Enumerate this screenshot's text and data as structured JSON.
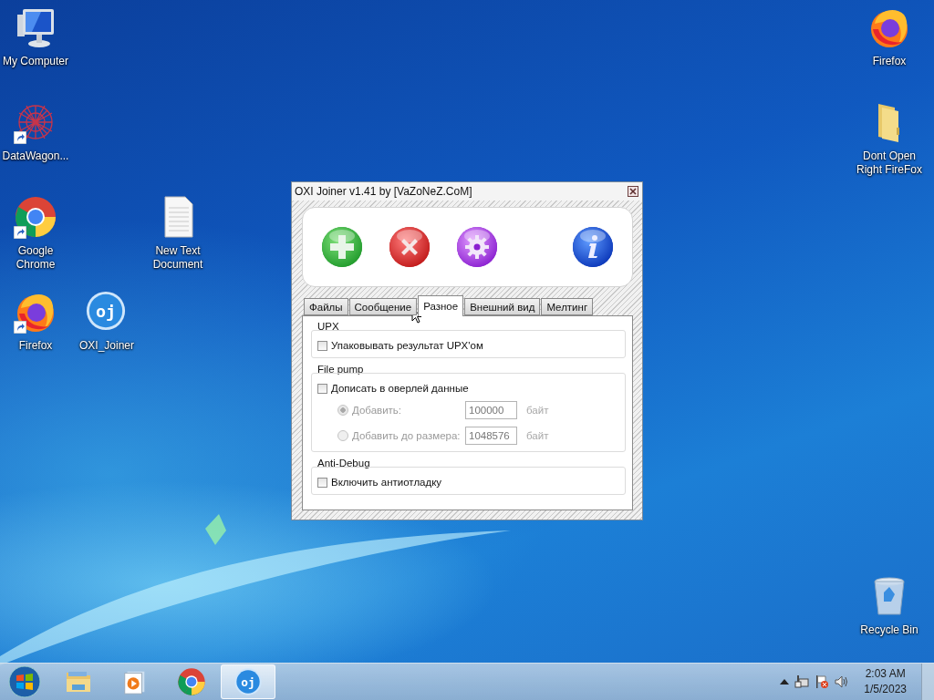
{
  "desktop_icons": [
    {
      "label": "My Computer",
      "kind": "computer",
      "shortcut": false
    },
    {
      "label": "Firefox",
      "kind": "firefox",
      "shortcut": false
    },
    {
      "label": "DataWagon...",
      "kind": "datawagon",
      "shortcut": true
    },
    {
      "label": "Dont Open Right FireFox",
      "kind": "folder",
      "shortcut": false
    },
    {
      "label": "Google Chrome",
      "kind": "chrome",
      "shortcut": true
    },
    {
      "label": "New Text Document",
      "kind": "textfile",
      "shortcut": false
    },
    {
      "label": "Firefox",
      "kind": "firefox",
      "shortcut": true
    },
    {
      "label": "OXI_Joiner",
      "kind": "oxi",
      "glyph": "oj",
      "shortcut": false
    },
    {
      "label": "Recycle Bin",
      "kind": "recycle",
      "shortcut": false
    }
  ],
  "window": {
    "title": "OXI Joiner v1.41 by [VaZoNeZ.CoM]",
    "toolbar": [
      {
        "kind": "add"
      },
      {
        "kind": "delete"
      },
      {
        "kind": "settings"
      },
      {
        "kind": "info"
      }
    ],
    "tabs": [
      {
        "label": "Файлы",
        "selected": false
      },
      {
        "label": "Сообщение",
        "selected": false
      },
      {
        "label": "Разное",
        "selected": true
      },
      {
        "label": "Внешний вид",
        "selected": false
      },
      {
        "label": "Мелтинг",
        "selected": false
      }
    ],
    "groups": [
      {
        "title": "UPX",
        "rows": [
          {
            "kind": "checkbox",
            "label": "Упаковывать результат UPX'ом",
            "checked": false
          }
        ]
      },
      {
        "title": "File pump",
        "rows": [
          {
            "kind": "checkbox",
            "label": "Дописать в оверлей данные",
            "checked": false
          },
          {
            "kind": "radio",
            "label": "Добавить:",
            "selected": true,
            "disabled": true,
            "value": "100000",
            "unit": "байт"
          },
          {
            "kind": "radio",
            "label": "Добавить до размера:",
            "selected": false,
            "disabled": true,
            "value": "1048576",
            "unit": "байт"
          }
        ]
      },
      {
        "title": "Anti-Debug",
        "rows": [
          {
            "kind": "checkbox",
            "label": "Включить антиотладку",
            "checked": false
          }
        ]
      }
    ]
  },
  "taskbar": {
    "apps": [
      {
        "kind": "explorer",
        "selected": false
      },
      {
        "kind": "media",
        "selected": false
      },
      {
        "kind": "chrome",
        "selected": false
      },
      {
        "kind": "oxi",
        "glyph": "oj",
        "selected": true
      }
    ],
    "time": "2:03 AM",
    "date": "1/5/2023"
  }
}
